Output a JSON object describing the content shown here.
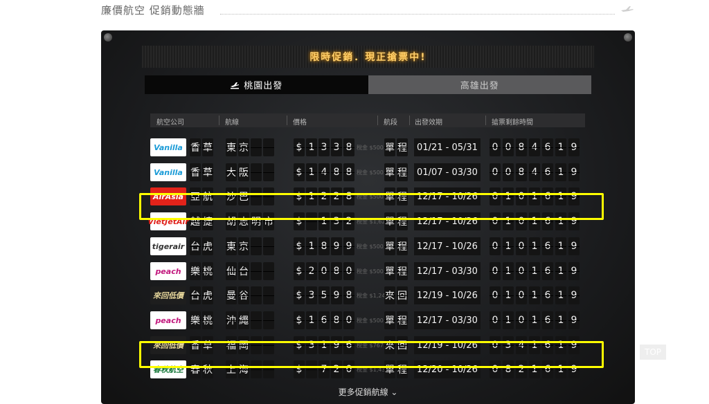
{
  "header": {
    "title": "廉價航空 促銷動態牆"
  },
  "board": {
    "headline": "限時促銷．現正搶票中!",
    "tabs": [
      {
        "label": "桃園出發"
      },
      {
        "label": "高雄出發"
      }
    ],
    "columns": [
      "航空公司",
      "航線",
      "價格",
      "航段",
      "出發效期",
      "搶票剩餘時間"
    ],
    "rows": [
      {
        "logo_text": "Vanilla",
        "logo_bg": "#ffffff",
        "logo_color": "#1a9bd7",
        "airline": [
          "香",
          "草"
        ],
        "route": [
          "東",
          "京"
        ],
        "price": [
          "$",
          "1",
          "3",
          "3",
          "8"
        ],
        "tax": "稅金 $500",
        "segment": [
          "單",
          "程"
        ],
        "dates": "01/21 - 05/31",
        "timer": [
          "0",
          "0",
          "8",
          "4",
          "6",
          "1",
          "9"
        ]
      },
      {
        "logo_text": "Vanilla",
        "logo_bg": "#ffffff",
        "logo_color": "#1a9bd7",
        "airline": [
          "香",
          "草"
        ],
        "route": [
          "大",
          "阪"
        ],
        "price": [
          "$",
          "1",
          "4",
          "8",
          "8"
        ],
        "tax": "稅金 $500",
        "segment": [
          "單",
          "程"
        ],
        "dates": "01/07 - 03/30",
        "timer": [
          "0",
          "0",
          "8",
          "4",
          "6",
          "1",
          "9"
        ]
      },
      {
        "logo_text": "AirAsia",
        "logo_bg": "#e2231a",
        "logo_color": "#ffffff",
        "airline": [
          "亞",
          "航"
        ],
        "route": [
          "沙",
          "巴"
        ],
        "price": [
          "$",
          "1",
          "2",
          "2",
          "8"
        ],
        "tax": "稅金 $500",
        "segment": [
          "單",
          "程"
        ],
        "dates": "12/17 - 10/26",
        "timer": [
          "0",
          "1",
          "0",
          "1",
          "6",
          "1",
          "9"
        ]
      },
      {
        "logo_text": "VietJetAir",
        "logo_bg": "#ffffff",
        "logo_color": "#e0201b",
        "airline": [
          "越",
          "捷"
        ],
        "route": [
          "胡",
          "志",
          "明",
          "市"
        ],
        "price": [
          "$",
          "",
          "1",
          "3",
          "2"
        ],
        "tax": "稅金 $1,627",
        "segment": [
          "單",
          "程"
        ],
        "dates": "12/17 - 10/26",
        "timer": [
          "0",
          "1",
          "0",
          "1",
          "6",
          "1",
          "9"
        ]
      },
      {
        "logo_text": "tigerair",
        "logo_bg": "#ffffff",
        "logo_color": "#333333",
        "airline": [
          "台",
          "虎"
        ],
        "route": [
          "東",
          "京"
        ],
        "price": [
          "$",
          "1",
          "8",
          "9",
          "9"
        ],
        "tax": "稅金 $500",
        "segment": [
          "單",
          "程"
        ],
        "dates": "12/17 - 10/26",
        "timer": [
          "0",
          "1",
          "0",
          "1",
          "6",
          "1",
          "9"
        ]
      },
      {
        "logo_text": "peach",
        "logo_bg": "#ffffff",
        "logo_color": "#c2187e",
        "airline": [
          "樂",
          "桃"
        ],
        "route": [
          "仙",
          "台"
        ],
        "price": [
          "$",
          "2",
          "0",
          "8",
          "0"
        ],
        "tax": "稅金 $500",
        "segment": [
          "單",
          "程"
        ],
        "dates": "12/17 - 03/30",
        "timer": [
          "0",
          "1",
          "0",
          "1",
          "6",
          "1",
          "9"
        ]
      },
      {
        "logo_text": "來回低價",
        "logo_bg": "#1e1e1e",
        "logo_color": "#e8d89c",
        "airline": [
          "台",
          "虎"
        ],
        "route": [
          "曼",
          "谷"
        ],
        "price": [
          "$",
          "3",
          "5",
          "9",
          "8"
        ],
        "tax": "稅金 $1,241",
        "segment": [
          "來",
          "回"
        ],
        "dates": "12/19 - 10/26",
        "timer": [
          "0",
          "1",
          "0",
          "1",
          "6",
          "1",
          "9"
        ]
      },
      {
        "logo_text": "peach",
        "logo_bg": "#ffffff",
        "logo_color": "#c2187e",
        "airline": [
          "樂",
          "桃"
        ],
        "route": [
          "沖",
          "繩"
        ],
        "price": [
          "$",
          "1",
          "6",
          "8",
          "0"
        ],
        "tax": "稅金 $500",
        "segment": [
          "單",
          "程"
        ],
        "dates": "12/17 - 03/30",
        "timer": [
          "0",
          "1",
          "0",
          "1",
          "6",
          "1",
          "9"
        ]
      },
      {
        "logo_text": "來回低價",
        "logo_bg": "#1e1e1e",
        "logo_color": "#e8d89c",
        "airline": [
          "香",
          "草"
        ],
        "route": [
          "福",
          "岡"
        ],
        "price": [
          "$",
          "3",
          "1",
          "9",
          "6"
        ],
        "tax": "稅金 $767",
        "segment": [
          "來",
          "回"
        ],
        "dates": "12/19 - 10/26",
        "timer": [
          "0",
          "3",
          "4",
          "1",
          "6",
          "1",
          "9"
        ]
      },
      {
        "logo_text": "春秋航空",
        "logo_bg": "#ffffff",
        "logo_color": "#1a7a3c",
        "airline": [
          "春",
          "秋"
        ],
        "route": [
          "上",
          "海"
        ],
        "price": [
          "$",
          "",
          "7",
          "2",
          "0"
        ],
        "tax": "稅金 $1,435",
        "segment": [
          "單",
          "程"
        ],
        "dates": "12/20 - 10/26",
        "timer": [
          "0",
          "8",
          "2",
          "1",
          "6",
          "1",
          "9"
        ]
      }
    ],
    "more_link": "更多促銷航線 ⌄"
  },
  "top_button": "TOP",
  "colors": {
    "highlight": "#ffff00",
    "headline": "#ffcf6b"
  }
}
